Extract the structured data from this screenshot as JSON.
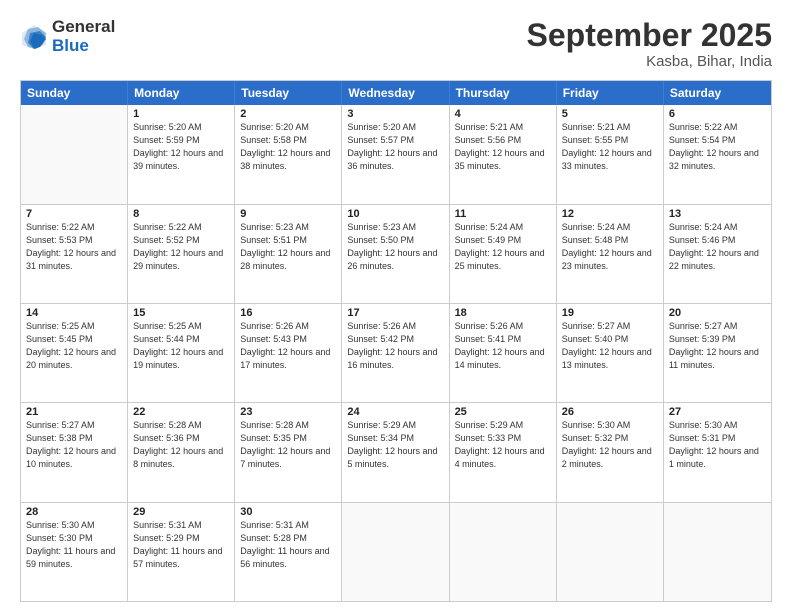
{
  "logo": {
    "general": "General",
    "blue": "Blue"
  },
  "title": "September 2025",
  "location": "Kasba, Bihar, India",
  "headers": [
    "Sunday",
    "Monday",
    "Tuesday",
    "Wednesday",
    "Thursday",
    "Friday",
    "Saturday"
  ],
  "weeks": [
    [
      {
        "day": "",
        "sunrise": "",
        "sunset": "",
        "daylight": ""
      },
      {
        "day": "1",
        "sunrise": "Sunrise: 5:20 AM",
        "sunset": "Sunset: 5:59 PM",
        "daylight": "Daylight: 12 hours and 39 minutes."
      },
      {
        "day": "2",
        "sunrise": "Sunrise: 5:20 AM",
        "sunset": "Sunset: 5:58 PM",
        "daylight": "Daylight: 12 hours and 38 minutes."
      },
      {
        "day": "3",
        "sunrise": "Sunrise: 5:20 AM",
        "sunset": "Sunset: 5:57 PM",
        "daylight": "Daylight: 12 hours and 36 minutes."
      },
      {
        "day": "4",
        "sunrise": "Sunrise: 5:21 AM",
        "sunset": "Sunset: 5:56 PM",
        "daylight": "Daylight: 12 hours and 35 minutes."
      },
      {
        "day": "5",
        "sunrise": "Sunrise: 5:21 AM",
        "sunset": "Sunset: 5:55 PM",
        "daylight": "Daylight: 12 hours and 33 minutes."
      },
      {
        "day": "6",
        "sunrise": "Sunrise: 5:22 AM",
        "sunset": "Sunset: 5:54 PM",
        "daylight": "Daylight: 12 hours and 32 minutes."
      }
    ],
    [
      {
        "day": "7",
        "sunrise": "Sunrise: 5:22 AM",
        "sunset": "Sunset: 5:53 PM",
        "daylight": "Daylight: 12 hours and 31 minutes."
      },
      {
        "day": "8",
        "sunrise": "Sunrise: 5:22 AM",
        "sunset": "Sunset: 5:52 PM",
        "daylight": "Daylight: 12 hours and 29 minutes."
      },
      {
        "day": "9",
        "sunrise": "Sunrise: 5:23 AM",
        "sunset": "Sunset: 5:51 PM",
        "daylight": "Daylight: 12 hours and 28 minutes."
      },
      {
        "day": "10",
        "sunrise": "Sunrise: 5:23 AM",
        "sunset": "Sunset: 5:50 PM",
        "daylight": "Daylight: 12 hours and 26 minutes."
      },
      {
        "day": "11",
        "sunrise": "Sunrise: 5:24 AM",
        "sunset": "Sunset: 5:49 PM",
        "daylight": "Daylight: 12 hours and 25 minutes."
      },
      {
        "day": "12",
        "sunrise": "Sunrise: 5:24 AM",
        "sunset": "Sunset: 5:48 PM",
        "daylight": "Daylight: 12 hours and 23 minutes."
      },
      {
        "day": "13",
        "sunrise": "Sunrise: 5:24 AM",
        "sunset": "Sunset: 5:46 PM",
        "daylight": "Daylight: 12 hours and 22 minutes."
      }
    ],
    [
      {
        "day": "14",
        "sunrise": "Sunrise: 5:25 AM",
        "sunset": "Sunset: 5:45 PM",
        "daylight": "Daylight: 12 hours and 20 minutes."
      },
      {
        "day": "15",
        "sunrise": "Sunrise: 5:25 AM",
        "sunset": "Sunset: 5:44 PM",
        "daylight": "Daylight: 12 hours and 19 minutes."
      },
      {
        "day": "16",
        "sunrise": "Sunrise: 5:26 AM",
        "sunset": "Sunset: 5:43 PM",
        "daylight": "Daylight: 12 hours and 17 minutes."
      },
      {
        "day": "17",
        "sunrise": "Sunrise: 5:26 AM",
        "sunset": "Sunset: 5:42 PM",
        "daylight": "Daylight: 12 hours and 16 minutes."
      },
      {
        "day": "18",
        "sunrise": "Sunrise: 5:26 AM",
        "sunset": "Sunset: 5:41 PM",
        "daylight": "Daylight: 12 hours and 14 minutes."
      },
      {
        "day": "19",
        "sunrise": "Sunrise: 5:27 AM",
        "sunset": "Sunset: 5:40 PM",
        "daylight": "Daylight: 12 hours and 13 minutes."
      },
      {
        "day": "20",
        "sunrise": "Sunrise: 5:27 AM",
        "sunset": "Sunset: 5:39 PM",
        "daylight": "Daylight: 12 hours and 11 minutes."
      }
    ],
    [
      {
        "day": "21",
        "sunrise": "Sunrise: 5:27 AM",
        "sunset": "Sunset: 5:38 PM",
        "daylight": "Daylight: 12 hours and 10 minutes."
      },
      {
        "day": "22",
        "sunrise": "Sunrise: 5:28 AM",
        "sunset": "Sunset: 5:36 PM",
        "daylight": "Daylight: 12 hours and 8 minutes."
      },
      {
        "day": "23",
        "sunrise": "Sunrise: 5:28 AM",
        "sunset": "Sunset: 5:35 PM",
        "daylight": "Daylight: 12 hours and 7 minutes."
      },
      {
        "day": "24",
        "sunrise": "Sunrise: 5:29 AM",
        "sunset": "Sunset: 5:34 PM",
        "daylight": "Daylight: 12 hours and 5 minutes."
      },
      {
        "day": "25",
        "sunrise": "Sunrise: 5:29 AM",
        "sunset": "Sunset: 5:33 PM",
        "daylight": "Daylight: 12 hours and 4 minutes."
      },
      {
        "day": "26",
        "sunrise": "Sunrise: 5:30 AM",
        "sunset": "Sunset: 5:32 PM",
        "daylight": "Daylight: 12 hours and 2 minutes."
      },
      {
        "day": "27",
        "sunrise": "Sunrise: 5:30 AM",
        "sunset": "Sunset: 5:31 PM",
        "daylight": "Daylight: 12 hours and 1 minute."
      }
    ],
    [
      {
        "day": "28",
        "sunrise": "Sunrise: 5:30 AM",
        "sunset": "Sunset: 5:30 PM",
        "daylight": "Daylight: 11 hours and 59 minutes."
      },
      {
        "day": "29",
        "sunrise": "Sunrise: 5:31 AM",
        "sunset": "Sunset: 5:29 PM",
        "daylight": "Daylight: 11 hours and 57 minutes."
      },
      {
        "day": "30",
        "sunrise": "Sunrise: 5:31 AM",
        "sunset": "Sunset: 5:28 PM",
        "daylight": "Daylight: 11 hours and 56 minutes."
      },
      {
        "day": "",
        "sunrise": "",
        "sunset": "",
        "daylight": ""
      },
      {
        "day": "",
        "sunrise": "",
        "sunset": "",
        "daylight": ""
      },
      {
        "day": "",
        "sunrise": "",
        "sunset": "",
        "daylight": ""
      },
      {
        "day": "",
        "sunrise": "",
        "sunset": "",
        "daylight": ""
      }
    ]
  ]
}
